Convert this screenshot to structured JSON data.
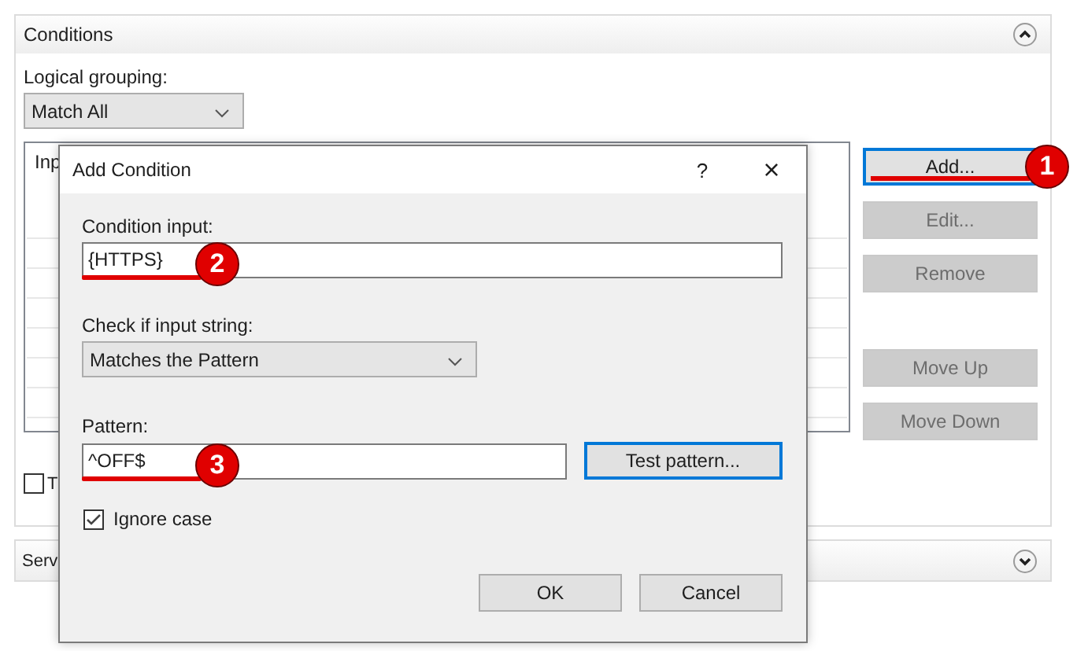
{
  "conditions": {
    "title": "Conditions",
    "expanded": true,
    "grouping_label": "Logical grouping:",
    "grouping": "Match All",
    "list_header": "Inp",
    "buttons": [
      {
        "label": "Add...",
        "disabled": false,
        "focused": true,
        "callout": "1"
      },
      {
        "label": "Edit...",
        "disabled": true,
        "focused": false
      },
      {
        "label": "Remove",
        "disabled": true,
        "focused": false
      },
      {
        "label": "Move Up",
        "disabled": true,
        "focused": false
      },
      {
        "label": "Move Down",
        "disabled": true,
        "focused": false
      }
    ],
    "checkbox": {
      "label": "T",
      "checked": false
    }
  },
  "services": {
    "title": "Serv",
    "expanded": false
  },
  "dialog": {
    "title": "Add Condition",
    "help": "?",
    "close": "×",
    "condition_input": {
      "label": "Condition input:",
      "value": "{HTTPS}",
      "callout": "2"
    },
    "check": {
      "label": "Check if input string:",
      "value": "Matches the Pattern"
    },
    "pattern": {
      "label": "Pattern:",
      "value": "^OFF$",
      "callout": "3"
    },
    "test_button": {
      "label": "Test pattern...",
      "focused": true
    },
    "ignore_case": {
      "label": "Ignore case",
      "checked": true
    },
    "buttons": [
      {
        "label": "OK"
      },
      {
        "label": "Cancel"
      }
    ]
  }
}
